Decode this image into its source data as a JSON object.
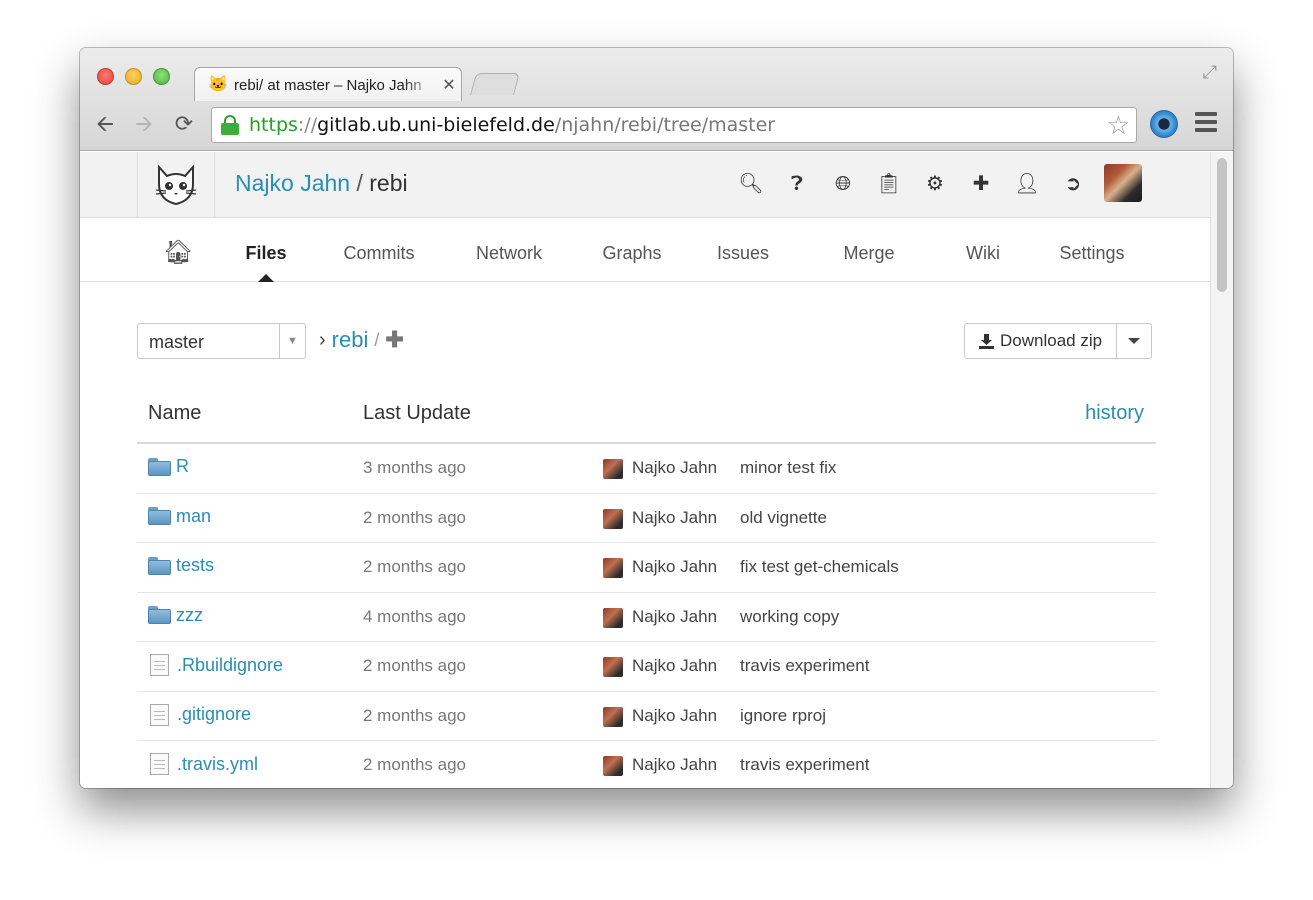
{
  "browser": {
    "tab_title": "rebi/ at master – Najko Jahn",
    "url": {
      "scheme": "https",
      "sep": "://",
      "host": "gitlab.ub.uni-bielefeld.de",
      "path": "/njahn/rebi/tree/master"
    }
  },
  "header": {
    "owner": "Najko Jahn",
    "slash": "/",
    "repo": "rebi",
    "icons": [
      "search-icon",
      "help-icon",
      "globe-icon",
      "snippets-icon",
      "admin-gears-icon",
      "new-project-icon",
      "profile-icon",
      "logout-icon"
    ]
  },
  "nav": {
    "items": [
      "Files",
      "Commits",
      "Network",
      "Graphs",
      "Issues",
      "Merge",
      "Wiki",
      "Settings"
    ],
    "active": "Files"
  },
  "toolbar": {
    "branch": "master",
    "breadcrumb_arrow": "›",
    "breadcrumb_repo": "rebi",
    "breadcrumb_slash": "/",
    "breadcrumb_plus": "✚",
    "download_label": "Download zip"
  },
  "table": {
    "headers": {
      "name": "Name",
      "last_update": "Last Update",
      "history": "history"
    },
    "rows": [
      {
        "type": "folder",
        "name": "R",
        "date": "3 months ago",
        "author": "Najko Jahn",
        "message": "minor test fix"
      },
      {
        "type": "folder",
        "name": "man",
        "date": "2 months ago",
        "author": "Najko Jahn",
        "message": "old vignette"
      },
      {
        "type": "folder",
        "name": "tests",
        "date": "2 months ago",
        "author": "Najko Jahn",
        "message": "fix test get-chemicals"
      },
      {
        "type": "folder",
        "name": "zzz",
        "date": "4 months ago",
        "author": "Najko Jahn",
        "message": "working copy"
      },
      {
        "type": "file",
        "name": ".Rbuildignore",
        "date": "2 months ago",
        "author": "Najko Jahn",
        "message": "travis experiment"
      },
      {
        "type": "file",
        "name": ".gitignore",
        "date": "2 months ago",
        "author": "Najko Jahn",
        "message": "ignore rproj"
      },
      {
        "type": "file",
        "name": ".travis.yml",
        "date": "2 months ago",
        "author": "Najko Jahn",
        "message": "travis experiment"
      }
    ]
  },
  "colors": {
    "link": "#2a8db2",
    "secure": "#22a022"
  }
}
